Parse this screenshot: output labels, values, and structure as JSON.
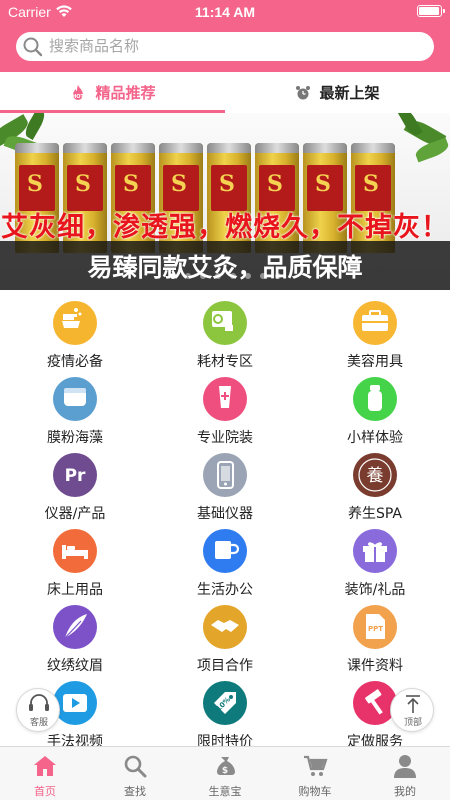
{
  "status_bar": {
    "carrier": "Carrier",
    "time": "11:14 AM",
    "battery_level": 0.95
  },
  "search": {
    "placeholder": "搜索商品名称",
    "value": ""
  },
  "tabs": [
    {
      "label": "精品推荐",
      "icon": "hot-fire-icon",
      "active": true
    },
    {
      "label": "最新上架",
      "icon": "alarm-clock-icon",
      "active": false
    }
  ],
  "banner": {
    "slogan_red": "艾灰细，渗透强，燃烧久，不掉灰！",
    "slogan_white": "易臻同款艾灸，品质保障",
    "slides_total": 8,
    "active_slide": 1
  },
  "categories": [
    {
      "label": "疫情必备",
      "icon": "hand-wash-icon",
      "color": "#f5b52e"
    },
    {
      "label": "耗材专区",
      "icon": "tissue-roll-icon",
      "color": "#8cc63f"
    },
    {
      "label": "美容用具",
      "icon": "toolbox-icon",
      "color": "#f7b733"
    },
    {
      "label": "膜粉海藻",
      "icon": "jar-icon",
      "color": "#5b9fd0"
    },
    {
      "label": "专业院装",
      "icon": "cream-tube-icon",
      "color": "#ef4f7e"
    },
    {
      "label": "小样体验",
      "icon": "sample-bottle-icon",
      "color": "#45d34a"
    },
    {
      "label": "仪器/产品",
      "icon": "pr-app-icon",
      "color": "#6e4c8f"
    },
    {
      "label": "基础仪器",
      "icon": "phone-device-icon",
      "color": "#9aa4b4"
    },
    {
      "label": "养生SPA",
      "icon": "yangsheng-seal-icon",
      "color": "#7a3c2e"
    },
    {
      "label": "床上用品",
      "icon": "bed-icon",
      "color": "#f26c3b"
    },
    {
      "label": "生活办公",
      "icon": "mug-icon",
      "color": "#2f7cf0"
    },
    {
      "label": "装饰/礼品",
      "icon": "gift-icon",
      "color": "#8a6bdc"
    },
    {
      "label": "纹绣纹眉",
      "icon": "feather-icon",
      "color": "#7d52c9"
    },
    {
      "label": "项目合作",
      "icon": "handshake-icon",
      "color": "#e3a52a"
    },
    {
      "label": "课件资料",
      "icon": "ppt-file-icon",
      "color": "#f2a14d"
    },
    {
      "label": "手法视频",
      "icon": "video-play-icon",
      "color": "#1f9be3"
    },
    {
      "label": "限时特价",
      "icon": "discount-tag-icon",
      "color": "#0f7a7c"
    },
    {
      "label": "定做服务",
      "icon": "hammer-icon",
      "color": "#e8326a"
    }
  ],
  "floating": {
    "service_label": "客服",
    "top_label": "顶部"
  },
  "bottom_nav": [
    {
      "label": "首页",
      "icon": "home-icon",
      "active": true
    },
    {
      "label": "查找",
      "icon": "magnifier-icon",
      "active": false
    },
    {
      "label": "生意宝",
      "icon": "money-bag-icon",
      "active": false
    },
    {
      "label": "购物车",
      "icon": "cart-icon",
      "active": false
    },
    {
      "label": "我的",
      "icon": "user-icon",
      "active": false
    }
  ],
  "colors": {
    "brand": "#f4648b",
    "nav_inactive": "#8a8a8a"
  }
}
